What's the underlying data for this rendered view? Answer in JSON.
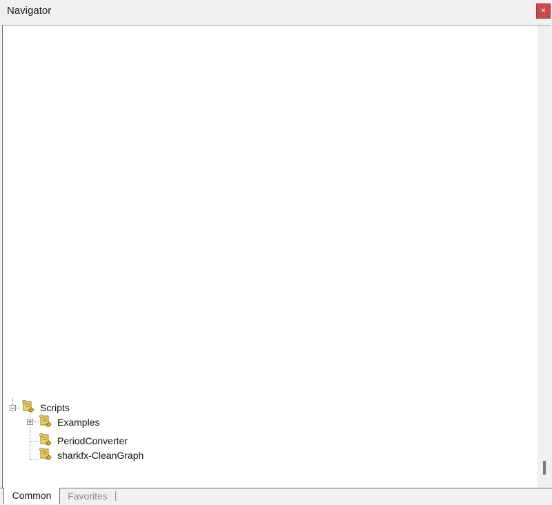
{
  "window": {
    "title": "Navigator",
    "close_glyph": "×",
    "accent_close": "#c94a4a"
  },
  "tree": {
    "items": [
      {
        "label": "Scripts",
        "icon": "script-scroll-icon",
        "expanded": true
      },
      {
        "label": "Examples",
        "icon": "script-scroll-icon",
        "expanded": false
      },
      {
        "label": "PeriodConverter",
        "icon": "script-scroll-icon"
      },
      {
        "label": "sharkfx-CleanGraph",
        "icon": "script-scroll-icon"
      }
    ]
  },
  "tabs": [
    {
      "label": "Common",
      "active": true
    },
    {
      "label": "Favorites",
      "active": false
    }
  ]
}
